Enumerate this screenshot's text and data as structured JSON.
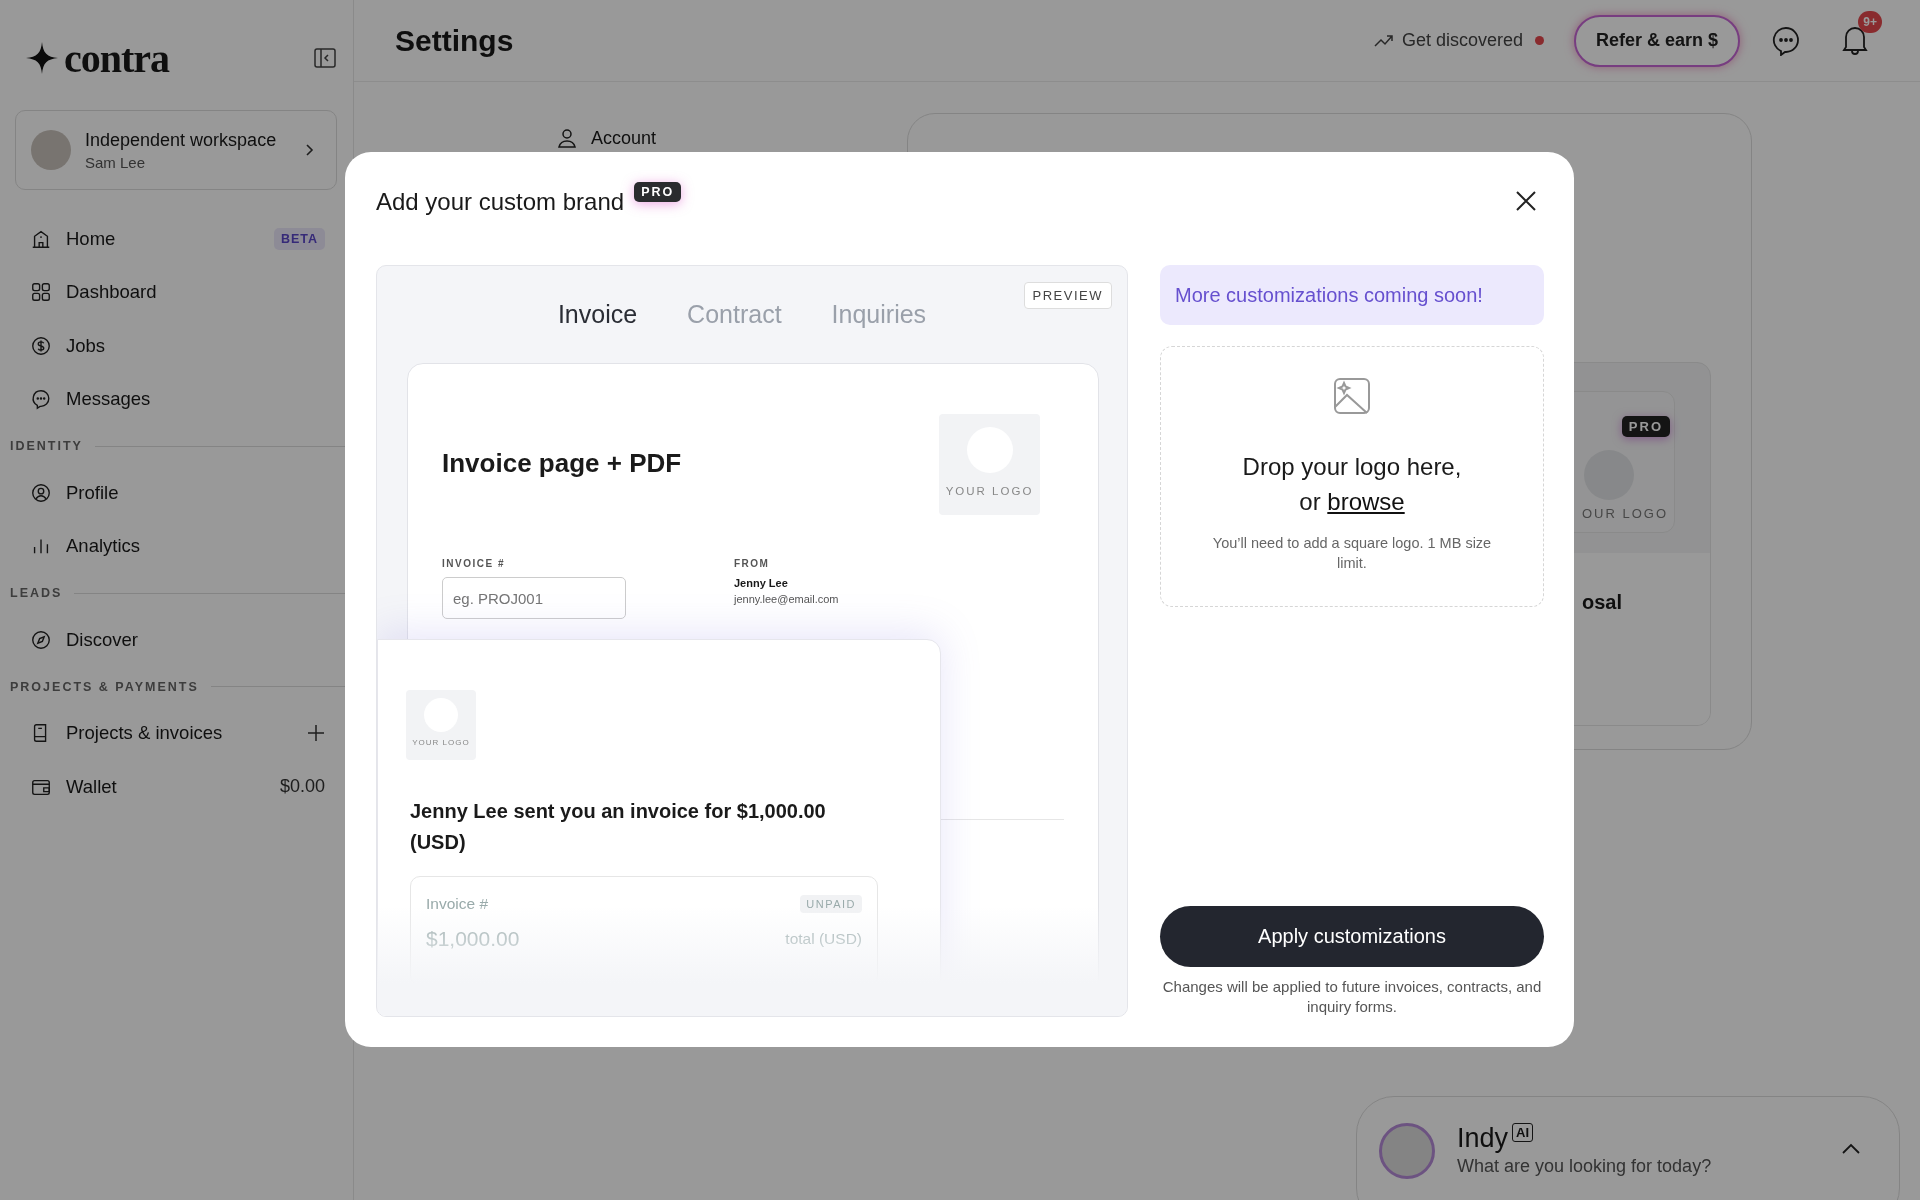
{
  "sidebar": {
    "logo": "contra",
    "workspace": {
      "name": "Independent workspace",
      "user": "Sam Lee"
    },
    "sections": [
      {
        "items": [
          {
            "label": "Home",
            "badge": "BETA",
            "selected": false,
            "add_button": false
          },
          {
            "label": "Dashboard",
            "selected": false,
            "add_button": false
          },
          {
            "label": "Jobs",
            "selected": false,
            "add_button": false
          },
          {
            "label": "Messages",
            "selected": false,
            "add_button": false
          }
        ]
      },
      {
        "heading": "IDENTITY",
        "items": [
          {
            "label": "Profile",
            "selected": false,
            "add_button": false
          },
          {
            "label": "Analytics",
            "selected": false,
            "add_button": false
          }
        ]
      },
      {
        "heading": "LEADS",
        "items": [
          {
            "label": "Discover",
            "selected": false,
            "add_button": false
          }
        ]
      },
      {
        "heading": "PROJECTS & PAYMENTS",
        "items": [
          {
            "label": "Projects & invoices",
            "selected": false,
            "add_button": true
          },
          {
            "label": "Wallet",
            "value": "$0.00",
            "selected": false,
            "add_button": false
          }
        ]
      }
    ]
  },
  "topbar": {
    "title": "Settings",
    "discover": {
      "label": "Get discovered",
      "dot": true
    },
    "refer_button": "Refer & earn $",
    "notification_count": "9+"
  },
  "settings_nav": [
    {
      "label": "Account"
    }
  ],
  "brand_card": {
    "badge": "PRO",
    "logo_text": "OUR LOGO",
    "title": "osal"
  },
  "modal": {
    "title": "Add your custom brand",
    "badge": "PRO",
    "preview": {
      "badge": "PREVIEW",
      "tabs": [
        {
          "label": "Invoice",
          "selected": true
        },
        {
          "label": "Contract",
          "selected": false
        },
        {
          "label": "Inquiries",
          "selected": false
        }
      ],
      "invoice_card": {
        "title": "Invoice page + PDF",
        "logo_text": "YOUR LOGO",
        "invoice_label": "INVOICE #",
        "invoice_placeholder": "eg. PROJ001",
        "from_label": "FROM",
        "from_name": "Jenny Lee",
        "from_email": "jenny.lee@email.com"
      },
      "email_card": {
        "logo_text": "YOUR LOGO",
        "message": "Jenny Lee sent you an invoice for $1,000.00 (USD)",
        "invoice_label": "Invoice #",
        "status": "UNPAID",
        "amount": "$1,000.00",
        "amount_note": "total (USD)"
      }
    },
    "notice": "More customizations coming soon!",
    "dropzone": {
      "title": "Drop your logo here,",
      "prefix": "or",
      "link": "browse",
      "hint": "You’ll need to add a square logo. 1 MB size limit."
    },
    "apply_button": "Apply customizations",
    "note": "Changes will be applied to future invoices, contracts, and inquiry forms."
  },
  "assistant": {
    "name": "Indy",
    "badge": "AI",
    "prompt": "What are you looking for today?"
  }
}
